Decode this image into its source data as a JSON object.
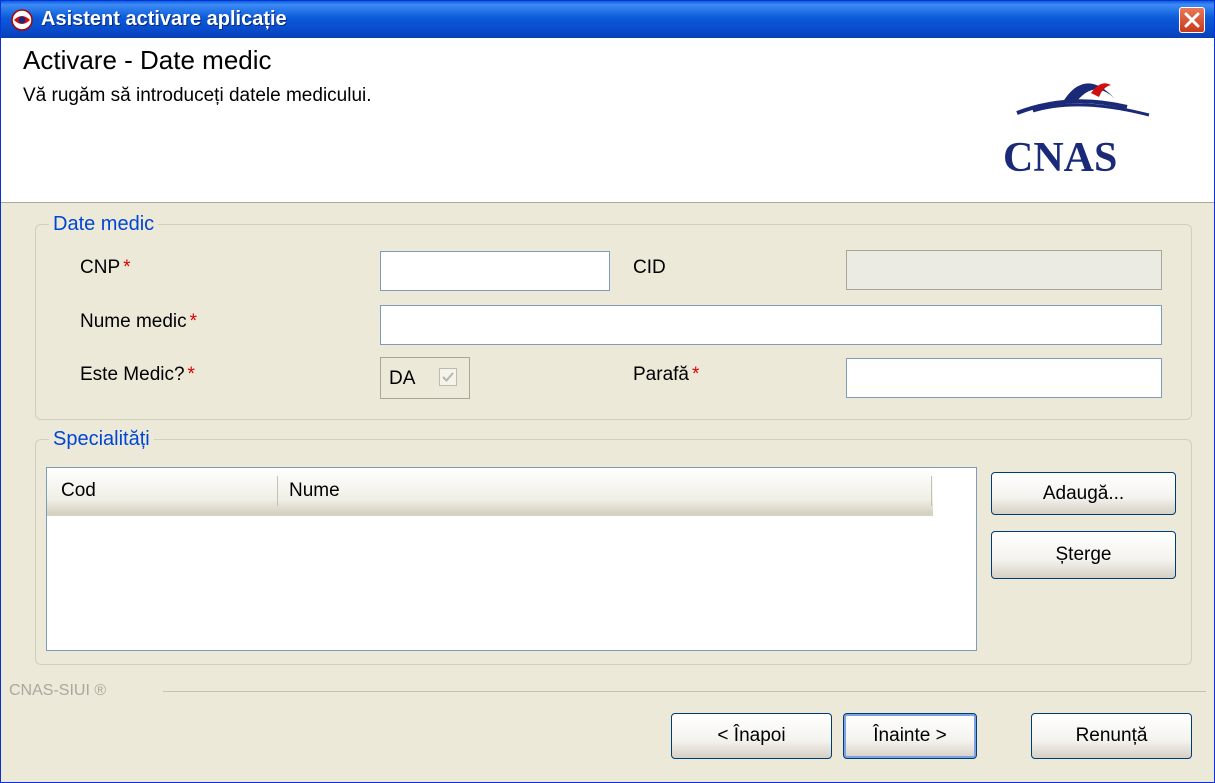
{
  "window": {
    "title": "Asistent activare aplicație",
    "close_label": "Close"
  },
  "header": {
    "title": "Activare - Date medic",
    "subtitle": "Vă rugăm să introduceți datele medicului.",
    "logo_text": "CNAS"
  },
  "date_medic": {
    "legend": "Date medic",
    "cnp": {
      "label": "CNP",
      "required_mark": "*",
      "value": ""
    },
    "cid": {
      "label": "CID",
      "value": ""
    },
    "nume_medic": {
      "label": "Nume medic",
      "required_mark": "*",
      "value": ""
    },
    "este_medic": {
      "label": "Este Medic?",
      "required_mark": "*",
      "value_text": "DA",
      "checked": true
    },
    "parafa": {
      "label": "Parafă",
      "required_mark": "*",
      "value": ""
    }
  },
  "specialitati": {
    "legend": "Specialități",
    "columns": [
      "Cod",
      "Nume"
    ],
    "rows": [],
    "add_button": "Adaugă...",
    "delete_button": "Șterge"
  },
  "footer": {
    "brand": "CNAS-SIUI ®",
    "back_button": "< Înapoi",
    "next_button": "Înainte >",
    "cancel_button": "Renunță"
  },
  "colors": {
    "title_bar": "#0a5fe0",
    "legend_text": "#0046d5",
    "required": "#e00000",
    "logo": "#1a2a78"
  }
}
